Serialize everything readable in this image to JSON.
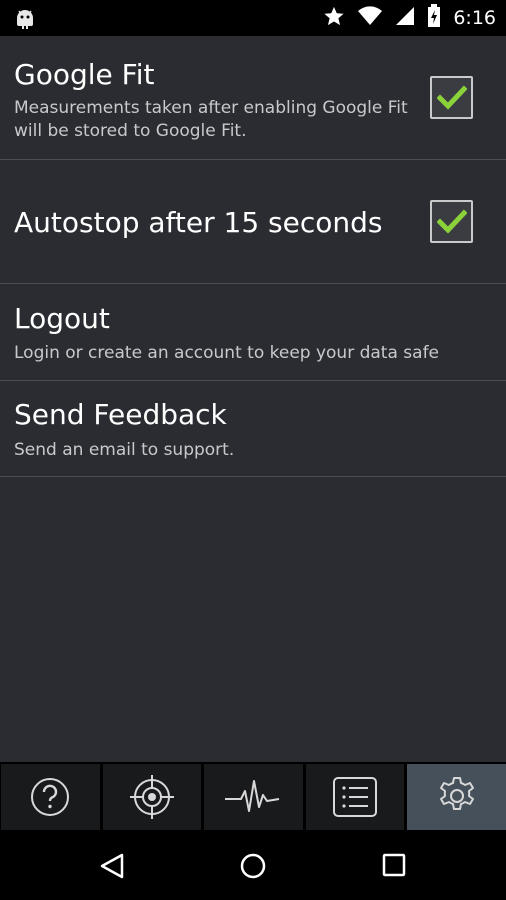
{
  "status_bar": {
    "time": "6:16",
    "icons": [
      "android-icon",
      "star-icon",
      "wifi-icon",
      "signal-icon",
      "battery-charging-icon"
    ]
  },
  "settings": [
    {
      "title": "Google Fit",
      "summary": "Measurements taken after enabling Google Fit will be stored to Google Fit.",
      "checked": true
    },
    {
      "title": "Autostop after 15 seconds",
      "summary": "",
      "checked": true
    },
    {
      "title": "Logout",
      "summary": "Login or create an account to keep your data safe"
    },
    {
      "title": "Send Feedback",
      "summary": "Send an email to support."
    }
  ],
  "tabs": [
    {
      "icon": "help-icon",
      "active": false
    },
    {
      "icon": "target-icon",
      "active": false
    },
    {
      "icon": "heartbeat-icon",
      "active": false
    },
    {
      "icon": "list-icon",
      "active": false
    },
    {
      "icon": "settings-gear-icon",
      "active": true
    }
  ],
  "nav_bar": {
    "icons": [
      "back-icon",
      "home-icon",
      "recents-icon"
    ]
  },
  "colors": {
    "background": "#2a2c31",
    "check_green": "#8bd23a",
    "active_tab": "#45505a",
    "divider": "#4a4d53"
  }
}
